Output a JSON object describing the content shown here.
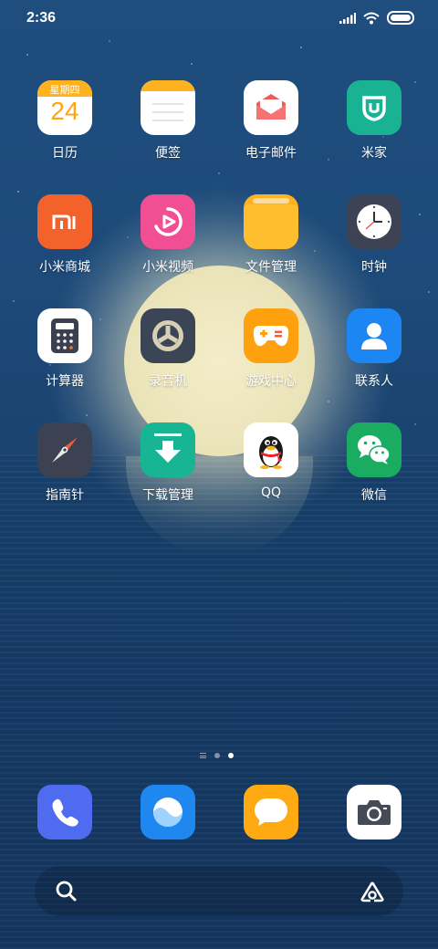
{
  "status_bar": {
    "time": "2:36",
    "icons": [
      "signal-icon",
      "wifi-icon",
      "battery-icon"
    ]
  },
  "calendar": {
    "weekday": "星期四",
    "day": "24"
  },
  "apps": [
    {
      "name": "app-calendar",
      "label": "日历",
      "icon": "calendar-icon",
      "color": "#ffffff"
    },
    {
      "name": "app-notes",
      "label": "便签",
      "icon": "notes-icon",
      "color": "#ffffff"
    },
    {
      "name": "app-email",
      "label": "电子邮件",
      "icon": "email-icon",
      "color": "#ffffff"
    },
    {
      "name": "app-mijia",
      "label": "米家",
      "icon": "mijia-icon",
      "color": "#19b394"
    },
    {
      "name": "app-mi-store",
      "label": "小米商城",
      "icon": "mi-store-icon",
      "color": "#f2622a"
    },
    {
      "name": "app-mi-video",
      "label": "小米视频",
      "icon": "video-icon",
      "color": "#f04f93"
    },
    {
      "name": "app-file-manager",
      "label": "文件管理",
      "icon": "folder-icon",
      "color": "#ffb21f"
    },
    {
      "name": "app-clock",
      "label": "时钟",
      "icon": "clock-icon",
      "color": "#3d4254"
    },
    {
      "name": "app-calculator",
      "label": "计算器",
      "icon": "calculator-icon",
      "color": "#ffffff"
    },
    {
      "name": "app-recorder",
      "label": "录音机",
      "icon": "recorder-icon",
      "color": "#3c4556"
    },
    {
      "name": "app-game-center",
      "label": "游戏中心",
      "icon": "gamepad-icon",
      "color": "#ffa10f"
    },
    {
      "name": "app-contacts",
      "label": "联系人",
      "icon": "contacts-icon",
      "color": "#1c86f2"
    },
    {
      "name": "app-compass",
      "label": "指南针",
      "icon": "compass-icon",
      "color": "#3c4252"
    },
    {
      "name": "app-downloads",
      "label": "下载管理",
      "icon": "download-icon",
      "color": "#18b595"
    },
    {
      "name": "app-qq",
      "label": "QQ",
      "icon": "qq-penguin-icon",
      "color": "#ffffff"
    },
    {
      "name": "app-wechat",
      "label": "微信",
      "icon": "wechat-icon",
      "color": "#1aad61"
    }
  ],
  "page_indicator": {
    "pages": 2,
    "active": 2
  },
  "dock": [
    {
      "name": "dock-phone",
      "icon": "phone-icon",
      "color": "#4f6cf0"
    },
    {
      "name": "dock-browser",
      "icon": "browser-icon",
      "color": "#1e88f0"
    },
    {
      "name": "dock-messages",
      "icon": "message-icon",
      "color": "#ffaa12"
    },
    {
      "name": "dock-camera",
      "icon": "camera-icon",
      "color": "#ffffff"
    }
  ],
  "search_bar": {
    "left_icon": "search-icon",
    "right_icon": "assistant-icon"
  }
}
